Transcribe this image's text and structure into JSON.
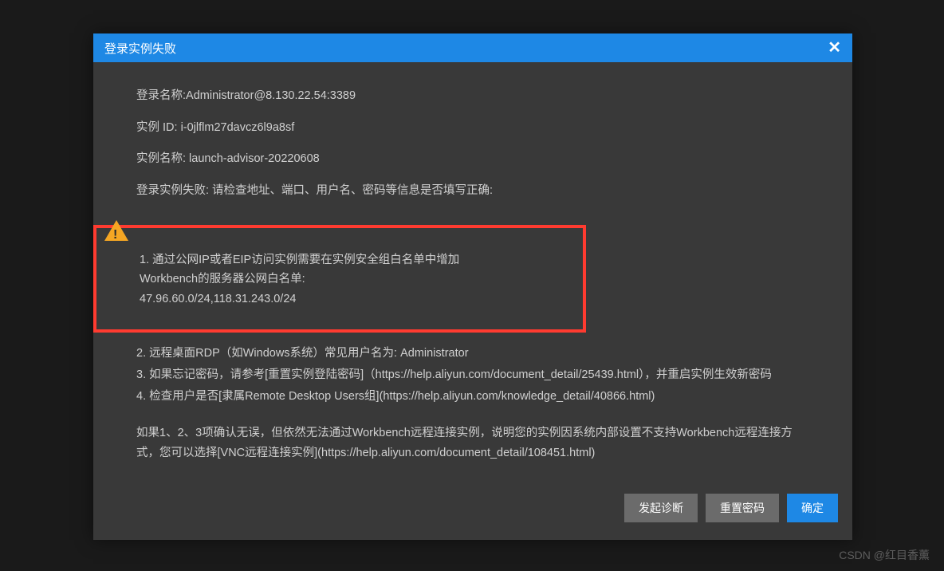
{
  "modal": {
    "title": "登录实例失败",
    "close": "✕"
  },
  "info": {
    "login_name": "登录名称:Administrator@8.130.22.54:3389",
    "instance_id": "实例 ID: i-0jlflm27davcz6l9a8sf",
    "instance_name": "实例名称: launch-advisor-20220608",
    "fail_msg": "登录实例失败: 请检查地址、端口、用户名、密码等信息是否填写正确:"
  },
  "highlight": {
    "line1": "1. 通过公网IP或者EIP访问实例需要在实例安全组白名单中增加",
    "line2": "Workbench的服务器公网白名单:",
    "line3": "47.96.60.0/24,118.31.243.0/24"
  },
  "steps": {
    "s2": "2. 远程桌面RDP（如Windows系统）常见用户名为: Administrator",
    "s3": "3. 如果忘记密码，请参考[重置实例登陆密码]（https://help.aliyun.com/document_detail/25439.html），并重启实例生效新密码",
    "s4": "4. 检查用户是否[隶属Remote Desktop Users组](https://help.aliyun.com/knowledge_detail/40866.html)"
  },
  "summary": {
    "text": "如果1、2、3项确认无误，但依然无法通过Workbench远程连接实例，说明您的实例因系统内部设置不支持Workbench远程连接方式，您可以选择[VNC远程连接实例](https://help.aliyun.com/document_detail/108451.html)"
  },
  "footer": {
    "diagnose": "发起诊断",
    "reset_pwd": "重置密码",
    "confirm": "确定"
  },
  "watermark": "CSDN @红目香薰"
}
